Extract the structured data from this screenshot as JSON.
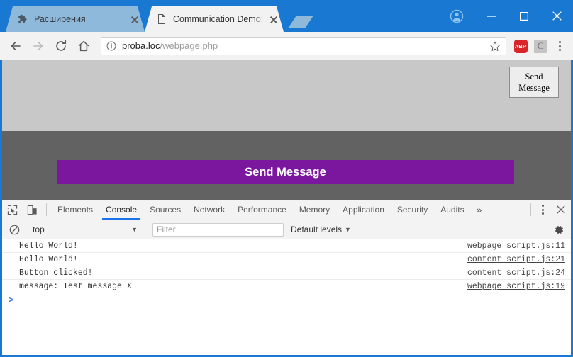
{
  "window": {
    "chrome_blue": "#1878d2",
    "controls": {
      "profile": "profile-avatar",
      "minimize": "minimize",
      "maximize": "maximize",
      "close": "close"
    }
  },
  "tabs": [
    {
      "title": "Расширения",
      "favicon": "puzzle-piece-icon",
      "active": false
    },
    {
      "title": "Communication Demo: c",
      "favicon": "page-icon",
      "active": true
    }
  ],
  "toolbar": {
    "back": "back-arrow",
    "forward": "forward-arrow",
    "reload": "reload",
    "home": "home",
    "url_host": "proba.loc",
    "url_path": "/webpage.php",
    "url_full": "proba.loc/webpage.php",
    "bookmark": "star-outline",
    "extensions": [
      {
        "name": "adblock-plus",
        "label": "ABP",
        "color": "#d9242a"
      },
      {
        "name": "extension-c",
        "label": "C",
        "color": "#c4c4c4"
      }
    ],
    "menu": "three-dot-menu"
  },
  "page": {
    "native_button_label": "Send\nMessage",
    "native_button_line1": "Send",
    "native_button_line2": "Message",
    "purple_button_label": "Send Message",
    "purple_color": "#7b169e",
    "top_bg": "#c8c8c8",
    "bottom_bg": "#626262"
  },
  "devtools": {
    "tool_icons": [
      "inspect-element-icon",
      "device-toolbar-icon"
    ],
    "tabs": [
      {
        "label": "Elements",
        "active": false
      },
      {
        "label": "Console",
        "active": true
      },
      {
        "label": "Sources",
        "active": false
      },
      {
        "label": "Network",
        "active": false
      },
      {
        "label": "Performance",
        "active": false
      },
      {
        "label": "Memory",
        "active": false
      },
      {
        "label": "Application",
        "active": false
      },
      {
        "label": "Security",
        "active": false
      },
      {
        "label": "Audits",
        "active": false
      }
    ],
    "overflow": "»",
    "kebab": "more-tools-menu",
    "close": "close-devtools",
    "filterbar": {
      "clear": "clear-console-icon",
      "context": "top",
      "context_caret": "▼",
      "filter_placeholder": "Filter",
      "filter_value": "",
      "levels": "Default levels",
      "levels_caret": "▼",
      "settings": "gear-icon"
    },
    "messages": [
      {
        "text": "Hello World!",
        "source": "webpage script.js:11"
      },
      {
        "text": "Hello World!",
        "source": "content script.js:21"
      },
      {
        "text": "Button clicked!",
        "source": "content script.js:24"
      },
      {
        "text": "message: Test message X",
        "source": "webpage script.js:19"
      }
    ],
    "prompt": ">"
  }
}
